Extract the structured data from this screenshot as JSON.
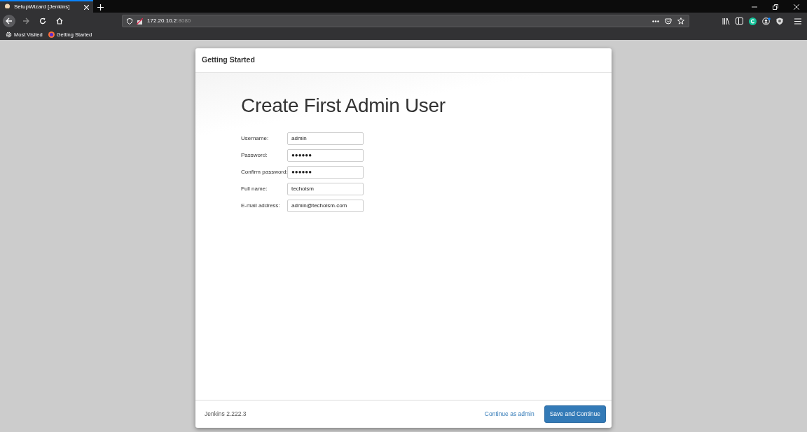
{
  "browser": {
    "tabs": [
      {
        "title": "SetupWizard [Jenkins]",
        "selected": true
      }
    ],
    "url": {
      "host": "172.20.10.2",
      "port": ":8080"
    },
    "bookmarks": [
      {
        "label": "Most Visited",
        "kind": "gear"
      },
      {
        "label": "Getting Started",
        "kind": "browser"
      }
    ]
  },
  "dialog": {
    "header": "Getting Started",
    "heading": "Create First Admin User",
    "fields": [
      {
        "label": "Username:",
        "value": "admin"
      },
      {
        "label": "Password:",
        "value": "●●●●●●"
      },
      {
        "label": "Confirm password:",
        "value": "●●●●●●"
      },
      {
        "label": "Full name:",
        "value": "techoism"
      },
      {
        "label": "E-mail address:",
        "value": "admin@techoism.com"
      }
    ],
    "version": "Jenkins 2.222.3",
    "link": "Continue as admin",
    "button": "Save and Continue"
  }
}
